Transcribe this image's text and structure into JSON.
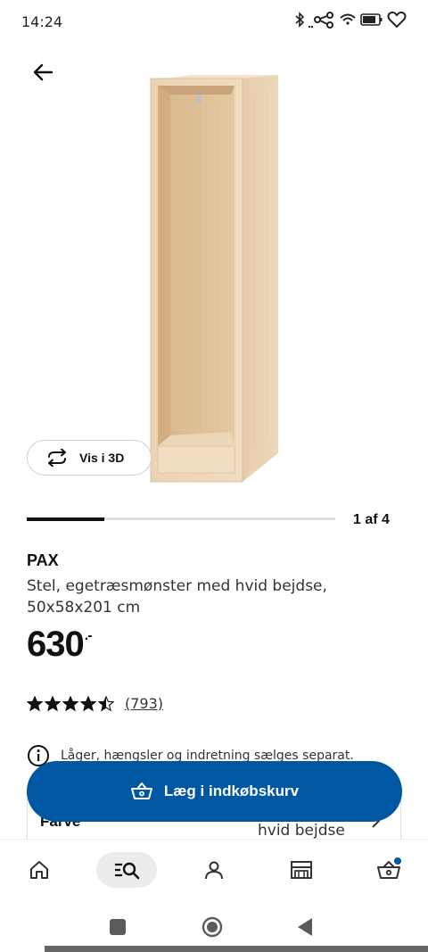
{
  "status_bar": {
    "time": "14:24",
    "icons": [
      "bluetooth-icon",
      "signal-icon",
      "wifi-icon",
      "battery-icon",
      "heart-icon"
    ]
  },
  "header": {
    "back_icon": "arrow-left-icon"
  },
  "gallery": {
    "view_3d_label": "Vis i 3D",
    "page_indicator": "1 af 4",
    "progress_fraction": 0.25
  },
  "product": {
    "name": "PAX",
    "description": "Stel, egetræsmønster med hvid bejdse, 50x58x201 cm",
    "price": "630",
    "price_suffix": ".-",
    "rating": 4.5,
    "review_count": "(793)",
    "info_text": "Låger, hængsler og indretning sælges separat.",
    "color_label": "Farve",
    "color_value": "hvid bejdse"
  },
  "actions": {
    "add_to_cart_label": "Læg i indkøbskurv",
    "accent_color": "#0058a3"
  },
  "bottom_nav": {
    "items": [
      "home-icon",
      "search-icon",
      "profile-icon",
      "store-icon",
      "cart-icon"
    ],
    "active": "search-icon"
  }
}
